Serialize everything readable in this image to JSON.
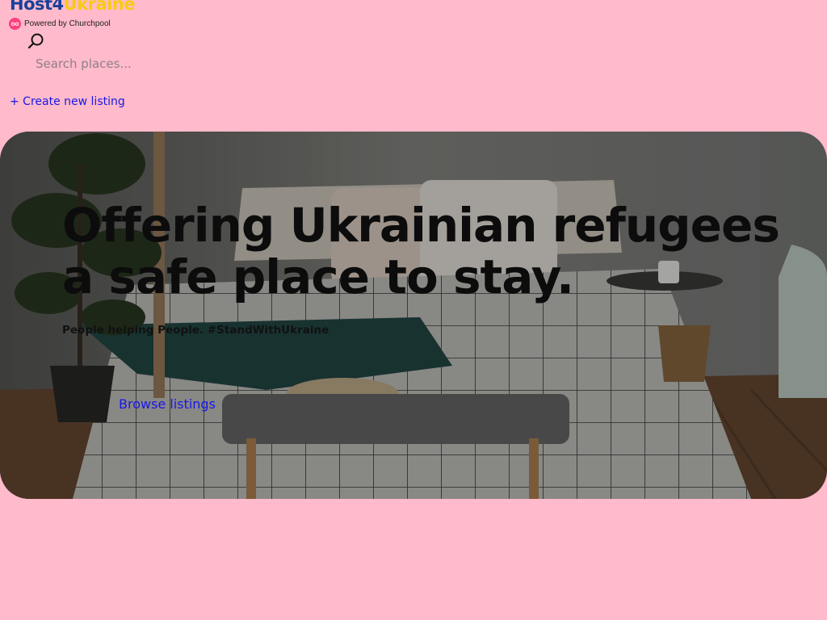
{
  "header": {
    "logo_part1": "Host4",
    "logo_part2": "Ukraine",
    "powered_by": "Powered by Churchpool",
    "badge_glyph": "oo",
    "search": {
      "icon": "search-icon",
      "placeholder": "Search places..."
    },
    "create_listing": "+ Create new listing"
  },
  "hero": {
    "title_line1": "Offering Ukrainian refugees",
    "title_line2": "a safe place to stay.",
    "subtitle": "People helping People. #StandWithUkraine",
    "browse": "Browse listings"
  },
  "colors": {
    "page_background": "#ffbacb",
    "logo_blue": "#17409a",
    "logo_yellow": "#f5cc14",
    "link_blue": "#1a17e6",
    "badge_pink": "#ff3f7f"
  }
}
